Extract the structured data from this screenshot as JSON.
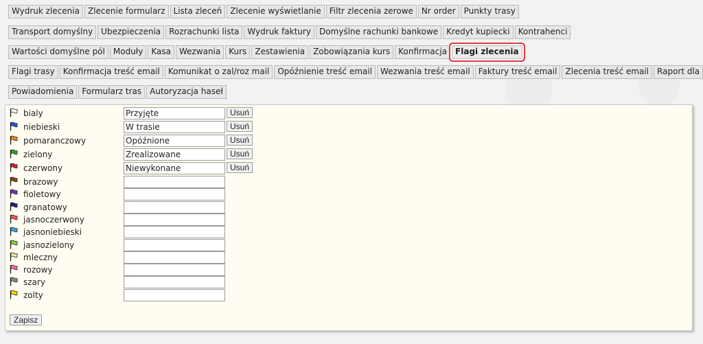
{
  "tabs": {
    "row1": [
      "Wydruk zlecenia",
      "Zlecenie formularz",
      "Lista zleceń",
      "Zlecenie wyświetlanie",
      "Filtr zlecenia zerowe",
      "Nr order",
      "Punkty trasy"
    ],
    "row2": [
      "Transport domyślny",
      "Ubezpieczenia",
      "Rozrachunki lista",
      "Wydruk faktury",
      "Domyślne rachunki bankowe",
      "Kredyt kupiecki",
      "Kontrahenci"
    ],
    "row3": [
      "Wartości domyślne pól",
      "Moduły",
      "Kasa",
      "Wezwania",
      "Kurs",
      "Zestawienia",
      "Zobowiązania kurs",
      "Konfirmacja",
      "Flagi zlecenia"
    ],
    "row4": [
      "Flagi trasy",
      "Konfirmacja treść email",
      "Komunikat o zal/roz mail",
      "Opóźnienie treść email",
      "Wezwania treść email",
      "Faktury treść email",
      "Zlecenia treść email",
      "Raport dla"
    ],
    "row5": [
      "Powiadomienia",
      "Formularz tras",
      "Autoryzacja haseł"
    ],
    "active": "Flagi zlecenia"
  },
  "flags": [
    {
      "name": "bialy",
      "value": "Przyjęte",
      "color": "#ffffff",
      "delete_label": "Usuń"
    },
    {
      "name": "niebieski",
      "value": "W trasie",
      "color": "#1e5bd6",
      "delete_label": "Usuń"
    },
    {
      "name": "pomaranczowy",
      "value": "Opóźnione",
      "color": "#f08a1c",
      "delete_label": "Usuń"
    },
    {
      "name": "zielony",
      "value": "Zrealizowane",
      "color": "#2fa52f",
      "delete_label": "Usuń"
    },
    {
      "name": "czerwony",
      "value": "Niewykonane",
      "color": "#d42424",
      "delete_label": "Usuń"
    },
    {
      "name": "brazowy",
      "value": "",
      "color": "#8b4513"
    },
    {
      "name": "fioletowy",
      "value": "",
      "color": "#7b2fbf"
    },
    {
      "name": "granatowy",
      "value": "",
      "color": "#1a237e"
    },
    {
      "name": "jasnoczerwony",
      "value": "",
      "color": "#ff5a5a"
    },
    {
      "name": "jasnoniebieski",
      "value": "",
      "color": "#39a7e6"
    },
    {
      "name": "jasnozielony",
      "value": "",
      "color": "#8ad43a"
    },
    {
      "name": "mleczny",
      "value": "",
      "color": "#f3e9a6"
    },
    {
      "name": "rozowy",
      "value": "",
      "color": "#ff69b4"
    },
    {
      "name": "szary",
      "value": "",
      "color": "#8a8a8a"
    },
    {
      "name": "zolty",
      "value": "",
      "color": "#f5d800"
    }
  ],
  "save_label": "Zapisz"
}
